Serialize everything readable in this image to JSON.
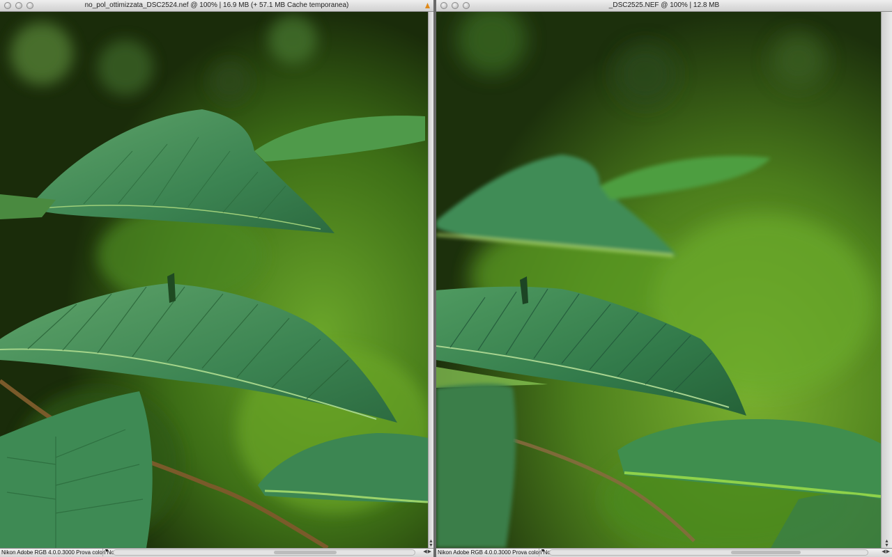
{
  "windows": {
    "left": {
      "title": "no_pol_ottimizzata_DSC2524.nef @ 100% | 16.9 MB (+ 57.1 MB Cache temporanea)",
      "status": "Nikon Adobe RGB 4.0.0.3000  Prova colori No"
    },
    "right": {
      "title": "_DSC2525.NEF @ 100% | 12.8 MB",
      "status": "Nikon Adobe RGB 4.0.0.3000  Prova colori No"
    }
  },
  "colors": {
    "background_dark": "#1b2a0c",
    "leaf_green": "#3f8a52",
    "leaf_highlight": "#8fd06a",
    "bokeh_green": "#5a9a2a",
    "branch": "#7a5a2a"
  },
  "icons": {
    "window_controls": [
      "close-icon",
      "minimize-icon",
      "zoom-icon"
    ],
    "status_menu": "triangle-down-icon"
  }
}
